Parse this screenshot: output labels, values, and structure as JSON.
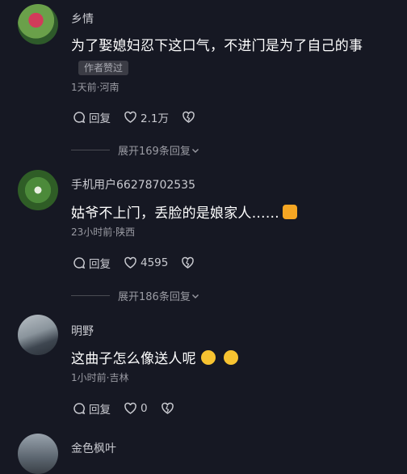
{
  "comments": [
    {
      "username": "乡情",
      "text": "为了娶媳妇忍下这口气，不进门是为了自己的事",
      "badge": "作者赞过",
      "meta": "1天前·河南",
      "reply_label": "回复",
      "likes": "2.1万",
      "expand": "展开169条回复"
    },
    {
      "username": "手机用户66278702535",
      "text": "姑爷不上门，丢脸的是娘家人……",
      "meta": "23小时前·陕西",
      "reply_label": "回复",
      "likes": "4595",
      "expand": "展开186条回复"
    },
    {
      "username": "明野",
      "text": "这曲子怎么像送人呢",
      "meta": "1小时前·吉林",
      "reply_label": "回复",
      "likes": "0"
    },
    {
      "username": "金色枫叶"
    }
  ],
  "icons": {
    "reply": "reply-bubble-icon",
    "like": "heart-icon",
    "dislike": "broken-heart-icon",
    "chevron": "chevron-down-icon"
  },
  "colors": {
    "background": "#161823",
    "text_primary": "#ffffff",
    "text_secondary": "#9a9ba3"
  }
}
